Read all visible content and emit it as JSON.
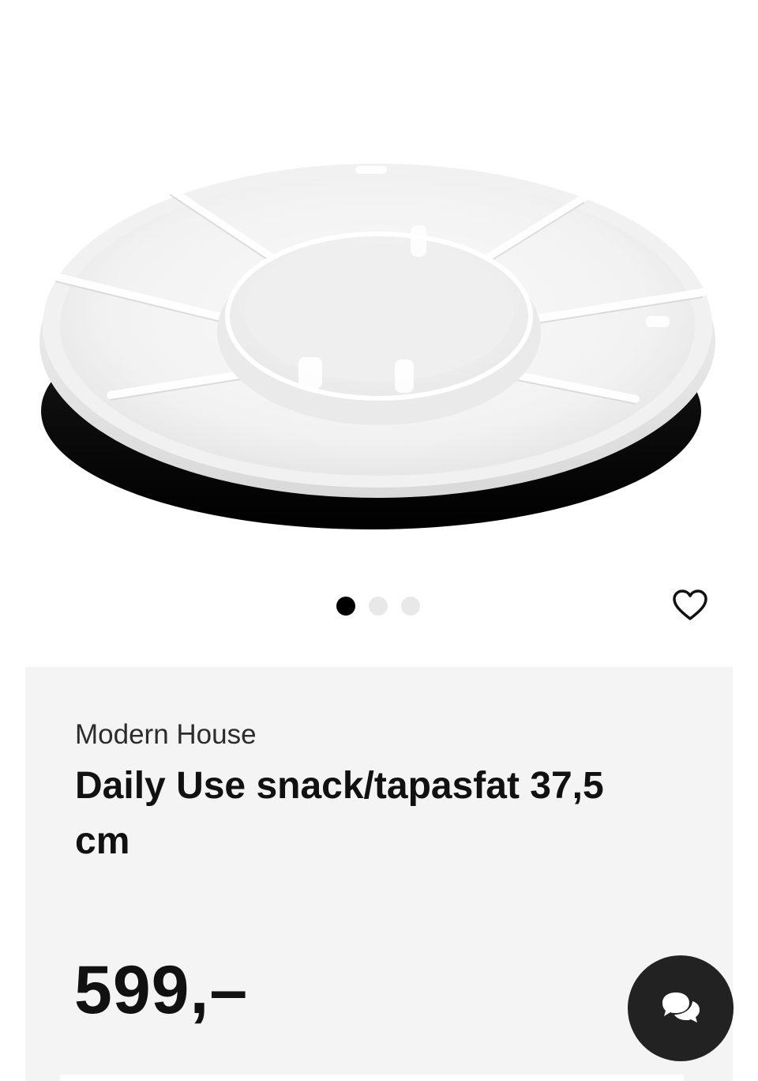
{
  "product": {
    "brand": "Modern House",
    "title": "Daily Use snack/tapasfat 37,5 cm",
    "price": "599,–"
  },
  "gallery": {
    "image_icon": "lazy-susan-serving-tray",
    "pager": {
      "total": 3,
      "active_index": 0
    }
  },
  "icons": {
    "favorite": "heart-outline-icon",
    "chat": "chat-bubbles-icon"
  },
  "colors": {
    "info_background": "#f4f4f4",
    "chat_button": "#222222",
    "text": "#111111",
    "dot_active": "#000000",
    "dot_inactive": "#e8e8e8"
  }
}
